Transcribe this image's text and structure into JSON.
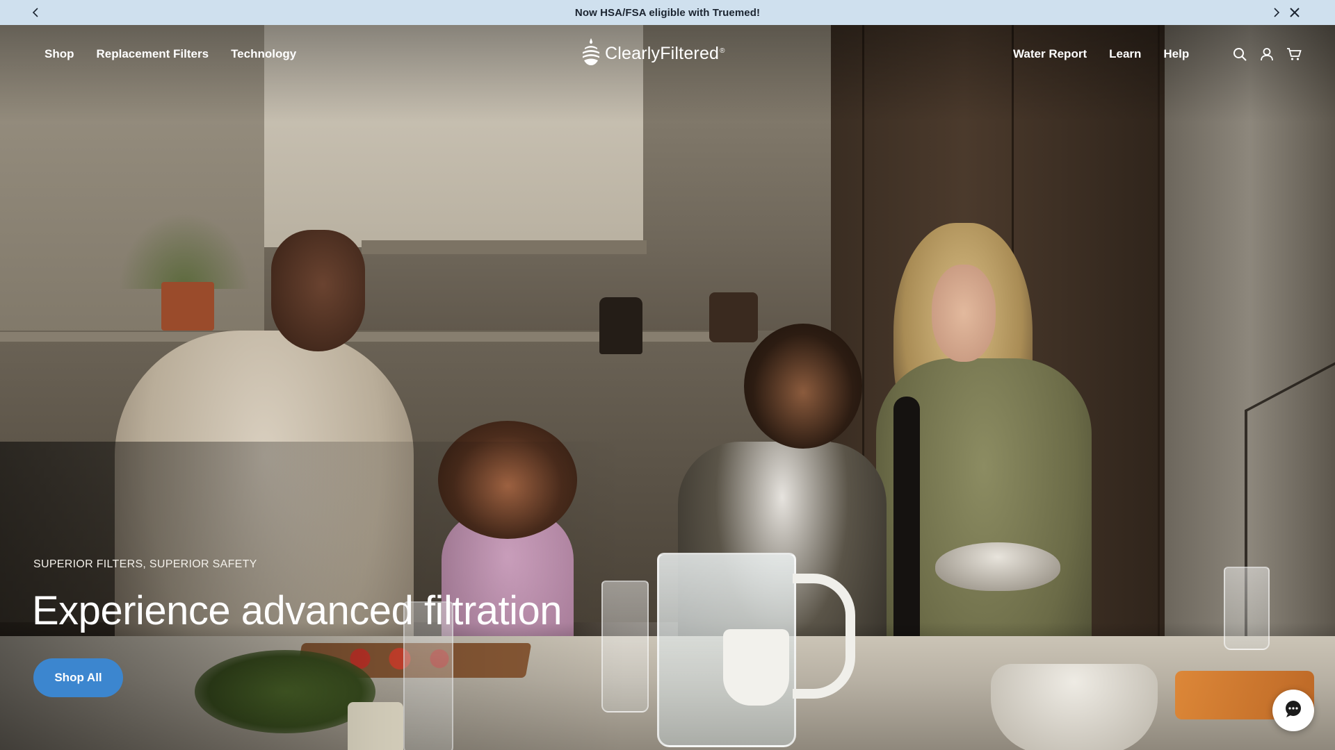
{
  "announcement": {
    "text": "Now HSA/FSA eligible with Truemed!",
    "prev_icon": "chevron-left-icon",
    "next_icon": "chevron-right-icon",
    "close_icon": "close-icon",
    "background": "#cfe0ee"
  },
  "header": {
    "nav_left": [
      "Shop",
      "Replacement Filters",
      "Technology"
    ],
    "logo_text": "ClearlyFiltered",
    "logo_mark": "®",
    "nav_right": [
      "Water Report",
      "Learn",
      "Help"
    ],
    "icons": [
      "search-icon",
      "account-icon",
      "cart-icon"
    ]
  },
  "hero": {
    "eyebrow": "SUPERIOR FILTERS, SUPERIOR SAFETY",
    "headline": "Experience advanced filtration",
    "cta_label": "Shop All",
    "cta_color": "#3c86cf"
  },
  "chat_widget": {
    "icon": "chat-bubble-icon"
  }
}
